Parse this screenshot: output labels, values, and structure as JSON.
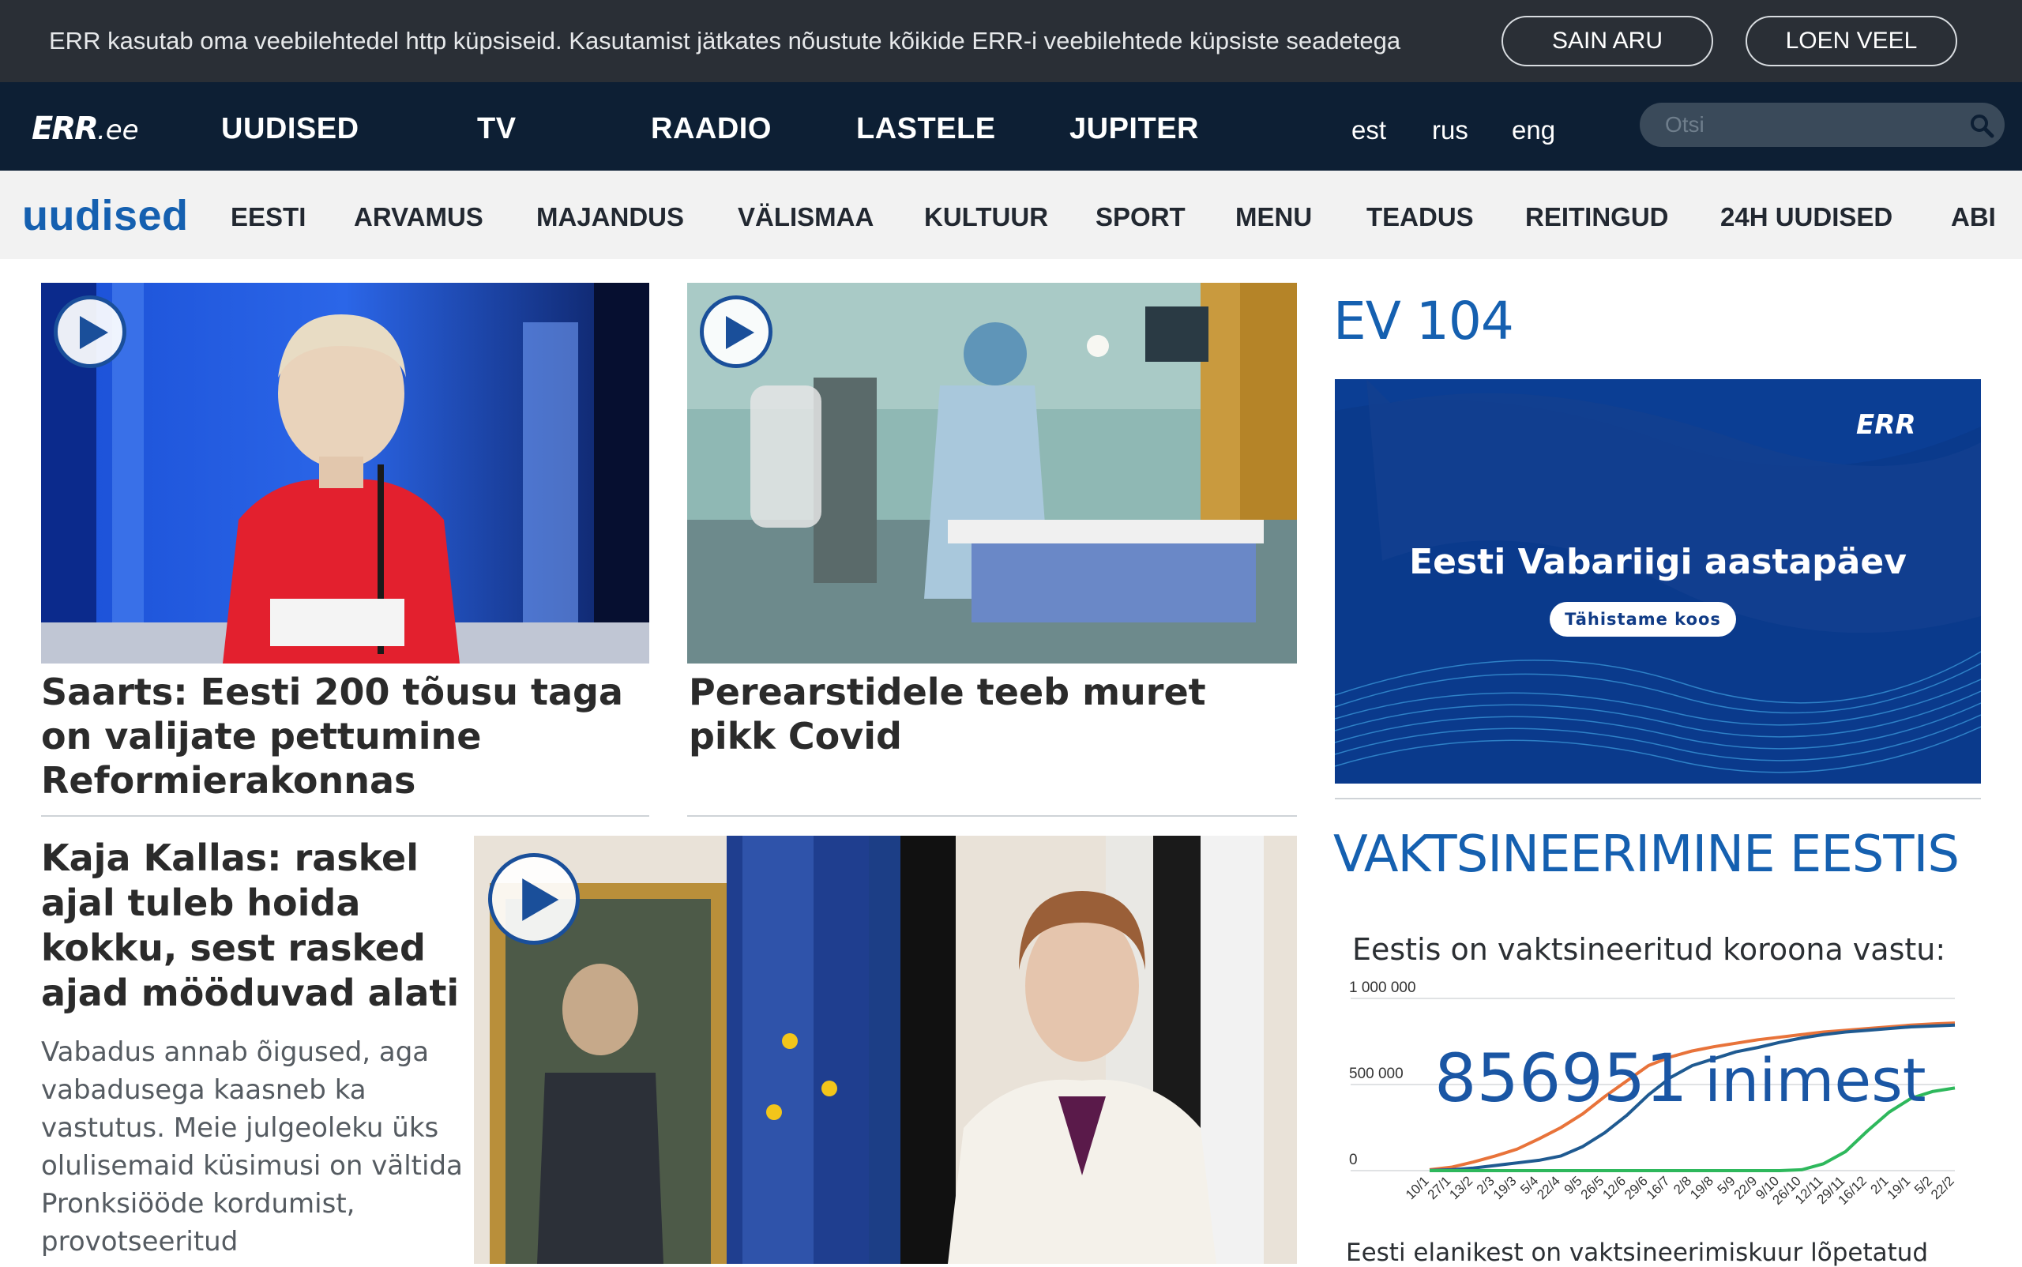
{
  "cookie": {
    "text": "ERR kasutab oma veebilehtedel http küpsiseid. Kasutamist jätkates nõustute kõikide ERR-i veebilehtede küpsiste seadetega",
    "accept_label": "SAIN ARU",
    "more_label": "LOEN VEEL"
  },
  "header": {
    "logo": "ERR",
    "logo_suffix": ".ee",
    "nav": [
      "UUDISED",
      "TV",
      "RAADIO",
      "LASTELE",
      "JUPITER"
    ],
    "languages": [
      "est",
      "rus",
      "eng"
    ],
    "search_placeholder": "Otsi"
  },
  "subnav": {
    "brand": "uudised",
    "items": [
      "EESTI",
      "ARVAMUS",
      "MAJANDUS",
      "VÄLISMAA",
      "KULTUUR",
      "SPORT",
      "MENU",
      "TEADUS",
      "REITINGUD",
      "24H UUDISED",
      "ABI"
    ]
  },
  "articles": [
    {
      "headline": "Saarts: Eesti 200 tõusu taga on valijate pettumine Reformierakonnas"
    },
    {
      "headline": "Perearstidele teeb muret pikk Covid"
    },
    {
      "headline": "Kaja Kallas: raskel ajal tuleb hoida kokku, sest rasked ajad mööduvad alati",
      "lead": "Vabadus annab õigused, aga vabadusega kaasneb ka vastutus. Meie julgeoleku üks olulisemaid küsimusi on vältida Pronksiööde kordumist, provotseeritud"
    }
  ],
  "sidebar": {
    "ev_title": "EV 104",
    "banner_logo": "ERR",
    "banner_title": "Eesti Vabariigi aastapäev",
    "banner_button": "Tähistame koos",
    "vacc_title": "VAKTSINEERIMINE EESTIS",
    "vacc_subtitle": "Eestis on vaktsineeritud koroona vastu:",
    "vacc_count": "856951",
    "vacc_unit": "inimest",
    "vacc_footer": "Eesti elanikest on vaktsineerimiskuur lõpetatud"
  },
  "colors": {
    "accent_blue": "#1560b0",
    "nav_dark": "#0d1f34",
    "cookie_bg": "#2a2f36"
  },
  "chart_data": {
    "type": "line",
    "ylim": [
      0,
      1000000
    ],
    "y_ticks": [
      "0",
      "500 000",
      "1 000 000"
    ],
    "categories": [
      "10/1",
      "27/1",
      "13/2",
      "2/3",
      "19/3",
      "5/4",
      "22/4",
      "9/5",
      "26/5",
      "12/6",
      "29/6",
      "16/7",
      "2/8",
      "19/8",
      "5/9",
      "22/9",
      "9/10",
      "26/10",
      "12/11",
      "29/11",
      "16/12",
      "2/1",
      "19/1",
      "5/2",
      "22/2"
    ],
    "series": [
      {
        "color": "#e8733a",
        "values": [
          5000,
          20000,
          50000,
          85000,
          125000,
          185000,
          250000,
          330000,
          430000,
          520000,
          610000,
          660000,
          695000,
          720000,
          740000,
          760000,
          775000,
          790000,
          805000,
          815000,
          825000,
          835000,
          845000,
          852000,
          857000
        ]
      },
      {
        "color": "#1f5a91",
        "values": [
          1000,
          5000,
          15000,
          30000,
          45000,
          60000,
          85000,
          140000,
          220000,
          320000,
          440000,
          540000,
          610000,
          650000,
          690000,
          715000,
          745000,
          770000,
          790000,
          805000,
          815000,
          825000,
          835000,
          840000,
          845000
        ]
      },
      {
        "color": "#2eb85c",
        "values": [
          0,
          0,
          0,
          0,
          0,
          0,
          0,
          0,
          0,
          0,
          0,
          0,
          0,
          0,
          0,
          0,
          0,
          5000,
          40000,
          110000,
          230000,
          340000,
          420000,
          460000,
          480000
        ]
      }
    ]
  }
}
